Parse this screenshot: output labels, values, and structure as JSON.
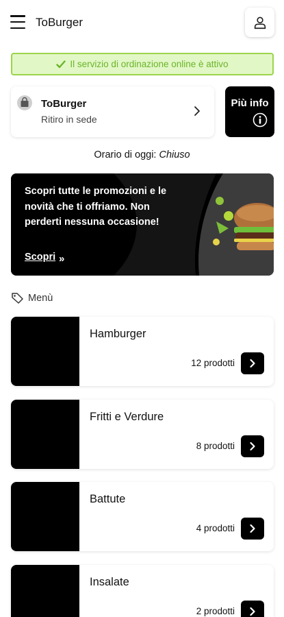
{
  "header": {
    "title": "ToBurger"
  },
  "status": {
    "message": "Il servizio di ordinazione online è attivo"
  },
  "store": {
    "name": "ToBurger",
    "mode": "Ritiro in sede"
  },
  "info_button": {
    "label": "Più info"
  },
  "hours": {
    "label": "Orario di oggi:",
    "value": "Chiuso"
  },
  "promo": {
    "text": "Scopri tutte le promozioni e le novità che ti offriamo. Non perderti nessuna occasione!",
    "link_label": "Scopri",
    "link_arrow": "»"
  },
  "menu": {
    "label": "Menù",
    "categories": [
      {
        "title": "Hamburger",
        "count": "12 prodotti"
      },
      {
        "title": "Fritti e Verdure",
        "count": "8 prodotti"
      },
      {
        "title": "Battute",
        "count": "4 prodotti"
      },
      {
        "title": "Insalate",
        "count": "2 prodotti"
      }
    ]
  },
  "colors": {
    "status_bg": "#e2f7c6",
    "status_border": "#9bd44a",
    "status_text": "#6ab52a",
    "accent": "#000000"
  }
}
